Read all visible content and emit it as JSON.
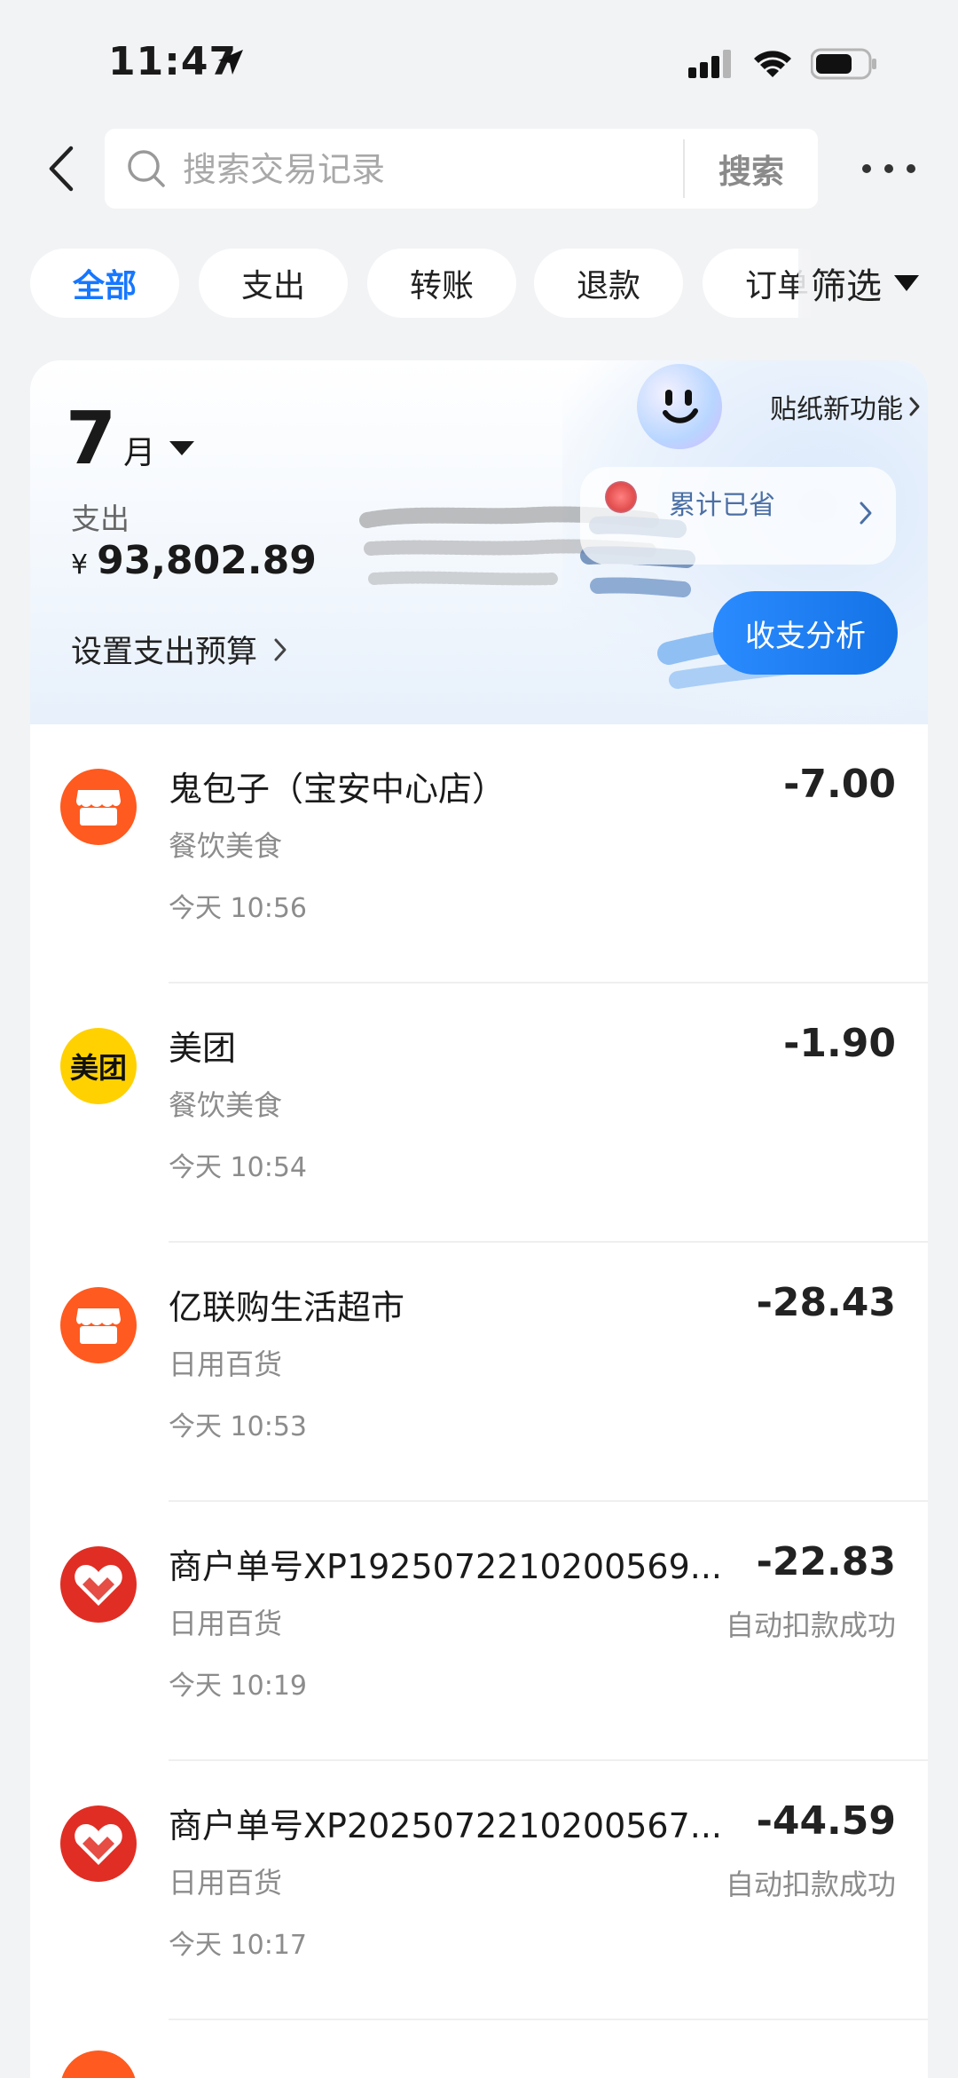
{
  "status_bar": {
    "time": "11:47"
  },
  "header": {
    "search_placeholder": "搜索交易记录",
    "search_button": "搜索"
  },
  "filters": {
    "chips": [
      "全部",
      "支出",
      "转账",
      "退款",
      "订单"
    ],
    "active_index": 0,
    "filter_label": "筛选"
  },
  "summary": {
    "month": "7",
    "month_unit": "月",
    "expense_label": "支出",
    "currency": "¥",
    "expense_amount": "93,802.89",
    "budget_link": "设置支出预算",
    "sticker_label": "贴纸新功能",
    "saved_label": "累计已省",
    "analysis_button": "收支分析"
  },
  "transactions": [
    {
      "name": "鬼包子（宝安中心店）",
      "category": "餐饮美食",
      "time": "今天 10:56",
      "amount": "-7.00",
      "status": "",
      "logo": "store-icon",
      "logo_color": "#ff5a1f"
    },
    {
      "name": "美团",
      "category": "餐饮美食",
      "time": "今天 10:54",
      "amount": "-1.90",
      "status": "",
      "logo": "meituan-logo",
      "logo_color": "#ffd100",
      "logo_text": "美团"
    },
    {
      "name": "亿联购生活超市",
      "category": "日用百货",
      "time": "今天 10:53",
      "amount": "-28.43",
      "status": "",
      "logo": "store-icon",
      "logo_color": "#ff5a1f"
    },
    {
      "name": "商户单号XP1925072210200569...",
      "category": "日用百货",
      "time": "今天 10:19",
      "amount": "-22.83",
      "status": "自动扣款成功",
      "logo": "pinduoduo-logo",
      "logo_color": "#e02e24"
    },
    {
      "name": "商户单号XP2025072210200567...",
      "category": "日用百货",
      "time": "今天 10:17",
      "amount": "-44.59",
      "status": "自动扣款成功",
      "logo": "pinduoduo-logo",
      "logo_color": "#e02e24"
    }
  ],
  "colors": {
    "accent": "#1677ff",
    "background": "#f2f3f5"
  }
}
